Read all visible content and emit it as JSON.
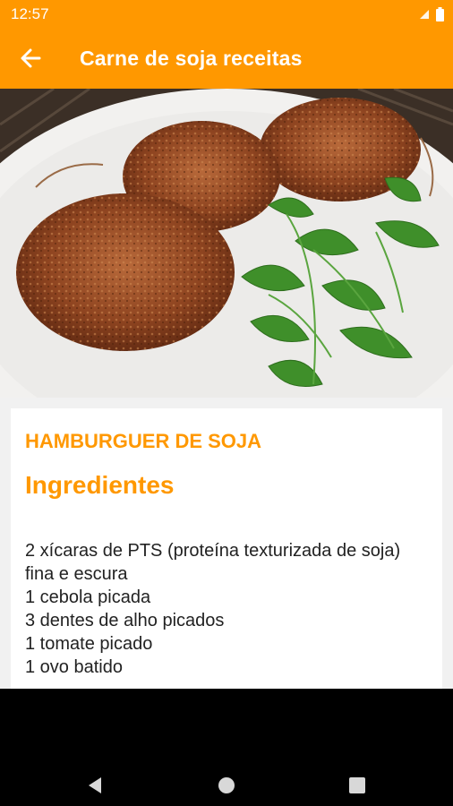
{
  "status_bar": {
    "time": "12:57",
    "icons": [
      "wifi-icon",
      "battery-icon"
    ]
  },
  "app_bar": {
    "title": "Carne de soja receitas",
    "back_icon": "arrow-left-icon",
    "color": "#ff9800"
  },
  "hero_image": {
    "icon": "food-photo"
  },
  "recipe": {
    "title": "HAMBURGUER DE SOJA",
    "section_heading": "Ingredientes",
    "ingredients": [
      "2 xícaras de PTS (proteína texturizada de soja) fina e escura",
      "1 cebola picada",
      "3 dentes de alho picados",
      "1 tomate picado",
      "1 ovo batido"
    ]
  },
  "nav_bar": {
    "buttons": [
      "back-triangle-icon",
      "home-circle-icon",
      "recents-square-icon"
    ]
  }
}
